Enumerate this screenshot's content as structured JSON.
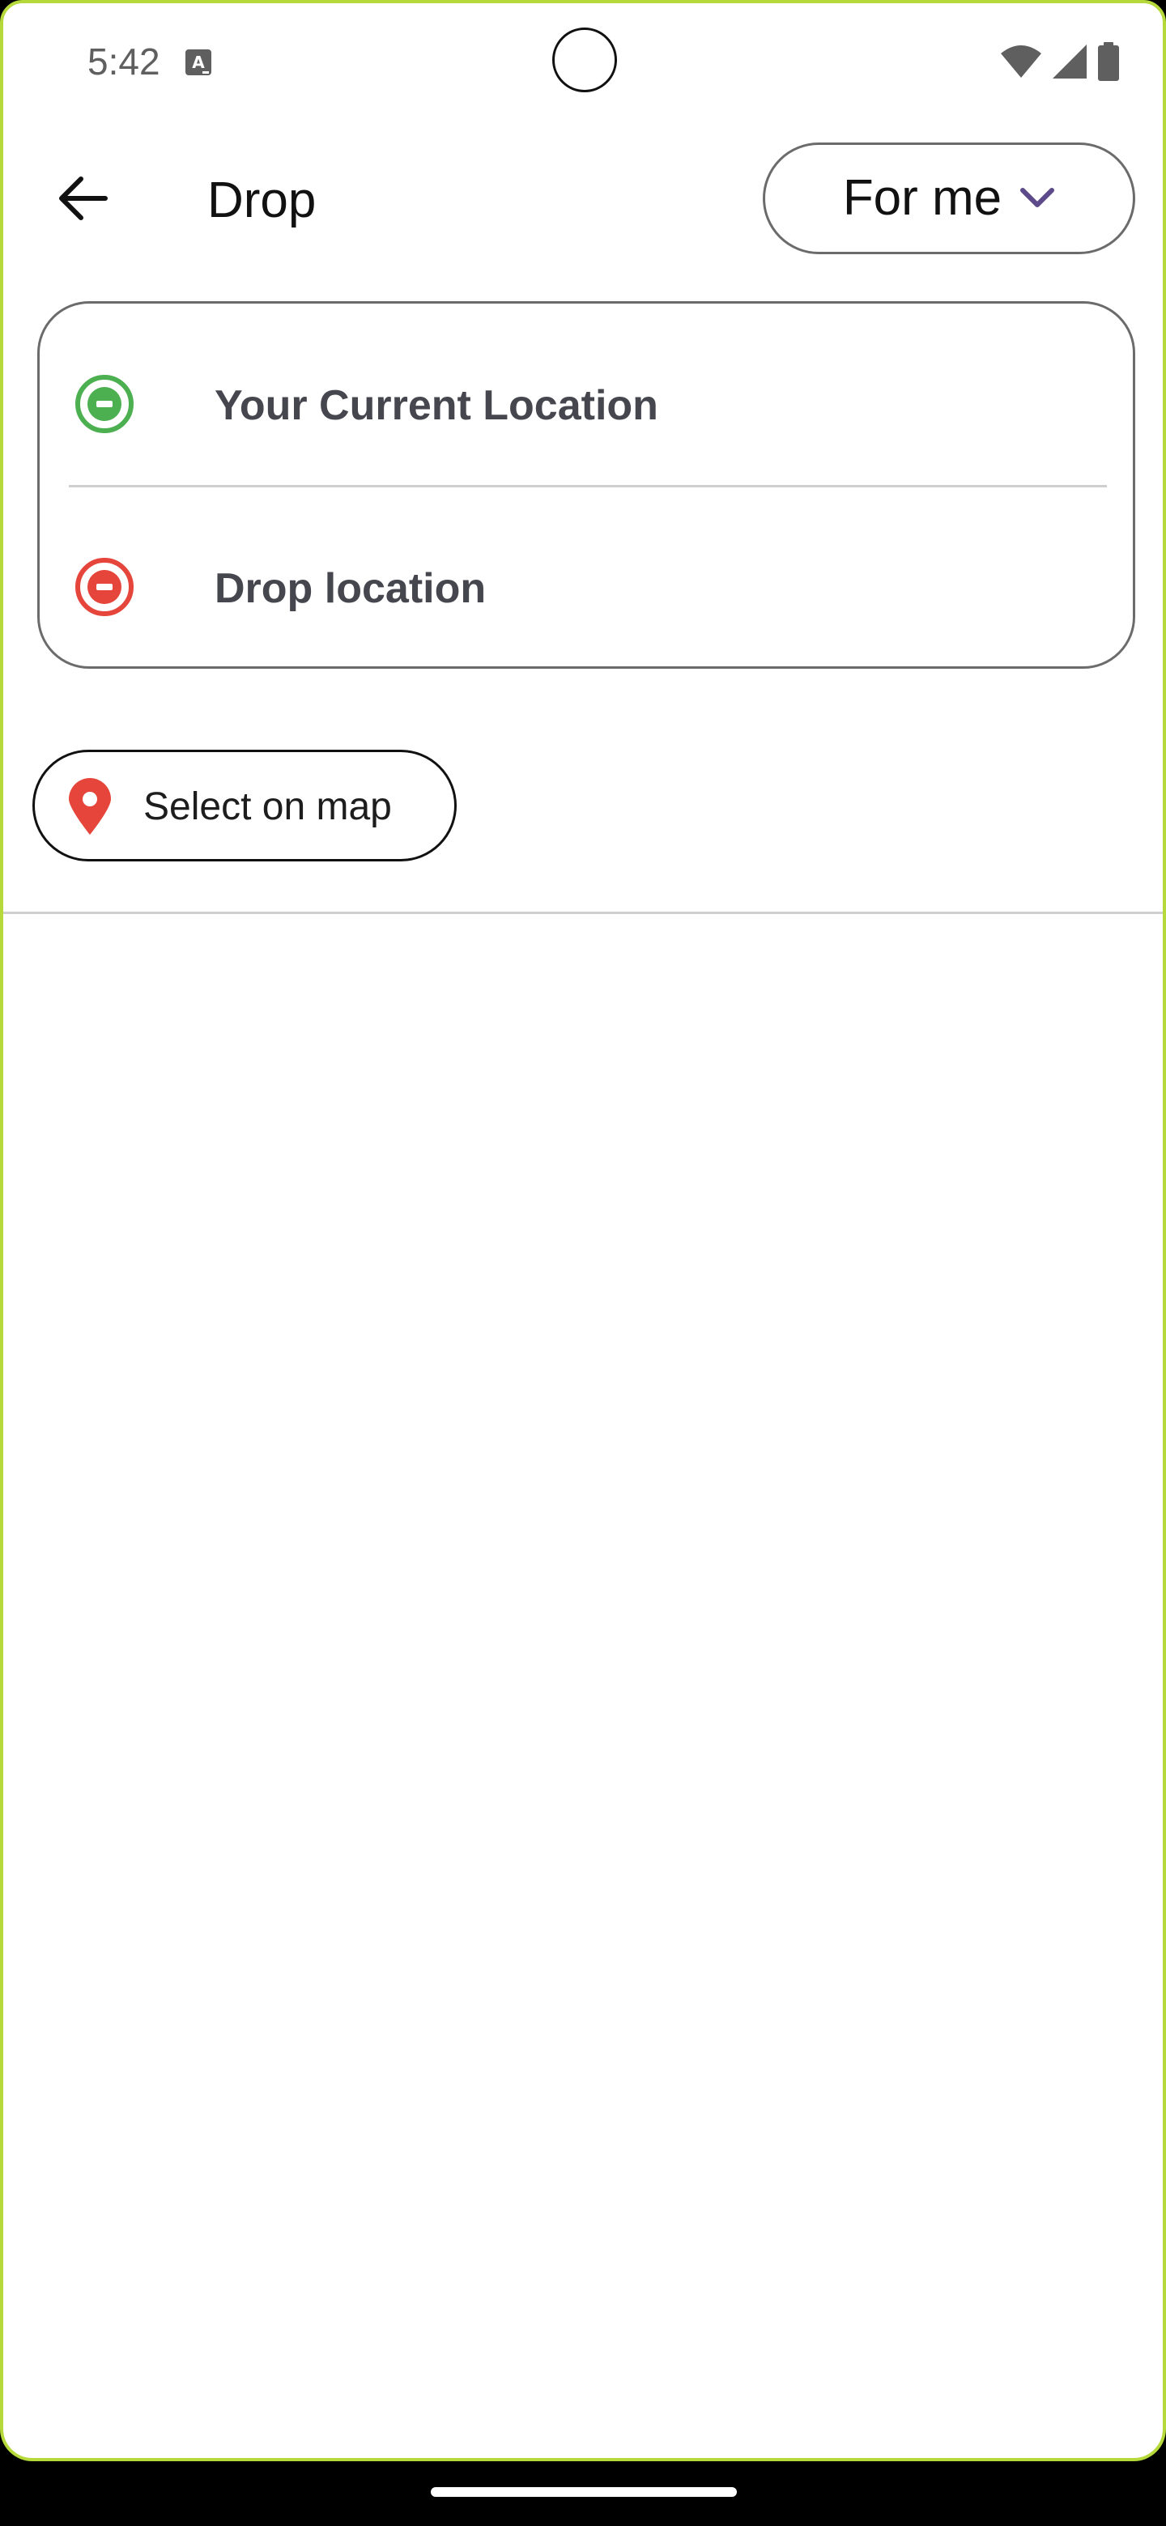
{
  "status_bar": {
    "time": "5:42",
    "notification_icon": "text-a-icon",
    "icons": [
      "wifi-icon",
      "signal-icon",
      "battery-icon"
    ]
  },
  "app_bar": {
    "back_icon": "arrow-left-icon",
    "title": "Drop",
    "rider_selector": {
      "value": "For me",
      "icon": "chevron-down-icon"
    }
  },
  "locations": {
    "pickup": {
      "text": "Your Current Location",
      "icon": "pickup-marker-icon",
      "color": "#4caf50"
    },
    "drop": {
      "placeholder": "Drop location",
      "icon": "drop-marker-icon",
      "color": "#e5453a"
    }
  },
  "map_chip": {
    "label": "Select on map",
    "icon": "map-pin-icon",
    "color": "#e5453a"
  },
  "colors": {
    "accent": "#5c4a8a",
    "frame": "#b5d93a",
    "text_primary": "#111111",
    "text_secondary": "#46464f"
  }
}
